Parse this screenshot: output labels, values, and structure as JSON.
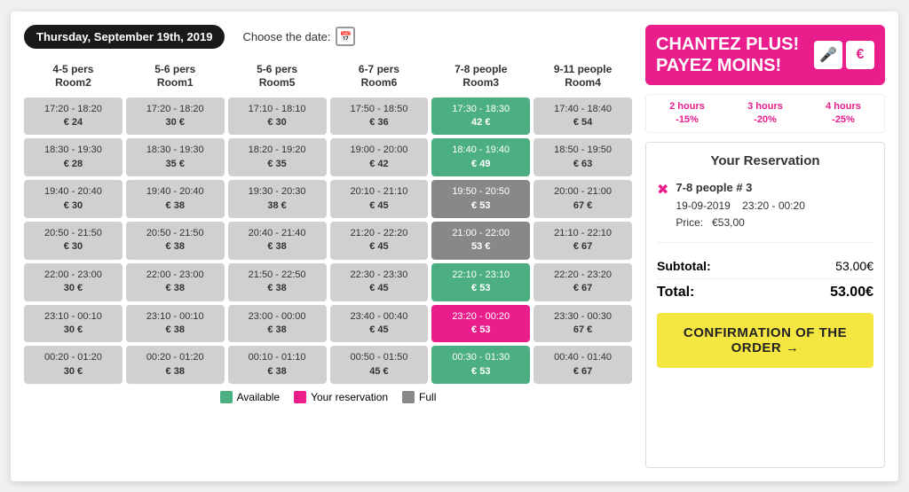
{
  "topBar": {
    "date": "Thursday, September 19th, 2019",
    "chooseDateLabel": "Choose the date:"
  },
  "promo": {
    "line1": "CHANTEZ PLUS!",
    "line2": "PAYEZ MOINS!",
    "icon1": "🎤",
    "icon2": "€",
    "discounts": [
      {
        "hours": "2 hours",
        "pct": "-15%"
      },
      {
        "hours": "3 hours",
        "pct": "-20%"
      },
      {
        "hours": "4 hours",
        "pct": "-25%"
      }
    ]
  },
  "columns": [
    {
      "label": "4-5 pers\nRoom2"
    },
    {
      "label": "5-6 pers\nRoom1"
    },
    {
      "label": "5-6 pers\nRoom5"
    },
    {
      "label": "6-7 pers\nRoom6"
    },
    {
      "label": "7-8 people\nRoom3"
    },
    {
      "label": "9-11 people\nRoom4"
    }
  ],
  "slots": [
    [
      {
        "time": "17:20 - 18:20",
        "price": "€ 24",
        "type": "default"
      },
      {
        "time": "17:20 - 18:20",
        "price": "30 €",
        "type": "default"
      },
      {
        "time": "17:10 - 18:10",
        "price": "€ 30",
        "type": "default"
      },
      {
        "time": "17:50 - 18:50",
        "price": "€ 36",
        "type": "default"
      },
      {
        "time": "17:30 - 18:30",
        "price": "42 €",
        "type": "available"
      },
      {
        "time": "17:40 - 18:40",
        "price": "€ 54",
        "type": "default"
      }
    ],
    [
      {
        "time": "18:30 - 19:30",
        "price": "€ 28",
        "type": "default"
      },
      {
        "time": "18:30 - 19:30",
        "price": "35 €",
        "type": "default"
      },
      {
        "time": "18:20 - 19:20",
        "price": "€ 35",
        "type": "default"
      },
      {
        "time": "19:00 - 20:00",
        "price": "€ 42",
        "type": "default"
      },
      {
        "time": "18:40 - 19:40",
        "price": "€ 49",
        "type": "available"
      },
      {
        "time": "18:50 - 19:50",
        "price": "€ 63",
        "type": "default"
      }
    ],
    [
      {
        "time": "19:40 - 20:40",
        "price": "€ 30",
        "type": "default"
      },
      {
        "time": "19:40 - 20:40",
        "price": "€ 38",
        "type": "default"
      },
      {
        "time": "19:30 - 20:30",
        "price": "38 €",
        "type": "default"
      },
      {
        "time": "20:10 - 21:10",
        "price": "€ 45",
        "type": "default"
      },
      {
        "time": "19:50 - 20:50",
        "price": "€ 53",
        "type": "full"
      },
      {
        "time": "20:00 - 21:00",
        "price": "67 €",
        "type": "default"
      }
    ],
    [
      {
        "time": "20:50 - 21:50",
        "price": "€ 30",
        "type": "default"
      },
      {
        "time": "20:50 - 21:50",
        "price": "€ 38",
        "type": "default"
      },
      {
        "time": "20:40 - 21:40",
        "price": "€ 38",
        "type": "default"
      },
      {
        "time": "21:20 - 22:20",
        "price": "€ 45",
        "type": "default"
      },
      {
        "time": "21:00 - 22:00",
        "price": "53 €",
        "type": "full"
      },
      {
        "time": "21:10 - 22:10",
        "price": "€ 67",
        "type": "default"
      }
    ],
    [
      {
        "time": "22:00 - 23:00",
        "price": "30 €",
        "type": "default"
      },
      {
        "time": "22:00 - 23:00",
        "price": "€ 38",
        "type": "default"
      },
      {
        "time": "21:50 - 22:50",
        "price": "€ 38",
        "type": "default"
      },
      {
        "time": "22:30 - 23:30",
        "price": "€ 45",
        "type": "default"
      },
      {
        "time": "22:10 - 23:10",
        "price": "€ 53",
        "type": "available"
      },
      {
        "time": "22:20 - 23:20",
        "price": "€ 67",
        "type": "default"
      }
    ],
    [
      {
        "time": "23:10 - 00:10",
        "price": "30 €",
        "type": "default"
      },
      {
        "time": "23:10 - 00:10",
        "price": "€ 38",
        "type": "default"
      },
      {
        "time": "23:00 - 00:00",
        "price": "€ 38",
        "type": "default"
      },
      {
        "time": "23:40 - 00:40",
        "price": "€ 45",
        "type": "default"
      },
      {
        "time": "23:20 - 00:20",
        "price": "€ 53",
        "type": "reserved"
      },
      {
        "time": "23:30 - 00:30",
        "price": "67 €",
        "type": "default"
      }
    ],
    [
      {
        "time": "00:20 - 01:20",
        "price": "30 €",
        "type": "default"
      },
      {
        "time": "00:20 - 01:20",
        "price": "€ 38",
        "type": "default"
      },
      {
        "time": "00:10 - 01:10",
        "price": "€ 38",
        "type": "default"
      },
      {
        "time": "00:50 - 01:50",
        "price": "45 €",
        "type": "default"
      },
      {
        "time": "00:30 - 01:30",
        "price": "€ 53",
        "type": "available"
      },
      {
        "time": "00:40 - 01:40",
        "price": "€ 67",
        "type": "default"
      }
    ]
  ],
  "legend": [
    {
      "label": "Available",
      "color": "#4caf82"
    },
    {
      "label": "Your reservation",
      "color": "#e91e8c"
    },
    {
      "label": "Full",
      "color": "#888"
    }
  ],
  "reservation": {
    "title": "Your Reservation",
    "room": "7-8 people # 3",
    "date": "19-09-2019",
    "time": "23:20  -  00:20",
    "priceLabel": "Price:",
    "price": "€53,00",
    "subtotalLabel": "Subtotal:",
    "subtotalAmount": "53.00€",
    "totalLabel": "Total:",
    "totalAmount": "53.00€",
    "confirmLabel": "CONFIRMATION OF THE ORDER →"
  }
}
